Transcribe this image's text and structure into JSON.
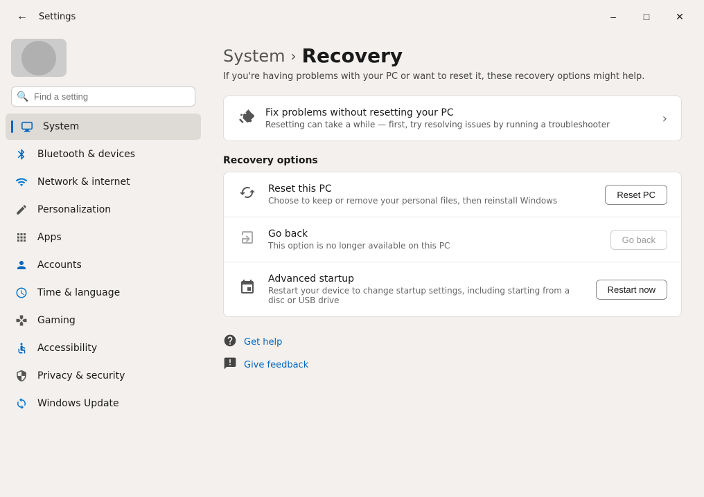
{
  "window": {
    "title": "Settings",
    "minimize": "–",
    "maximize": "□",
    "close": "✕"
  },
  "search": {
    "placeholder": "Find a setting"
  },
  "nav": {
    "items": [
      {
        "id": "system",
        "label": "System",
        "icon": "🖥",
        "active": true
      },
      {
        "id": "bluetooth",
        "label": "Bluetooth & devices",
        "icon": "🔵",
        "active": false
      },
      {
        "id": "network",
        "label": "Network & internet",
        "icon": "📶",
        "active": false
      },
      {
        "id": "personalization",
        "label": "Personalization",
        "icon": "✏️",
        "active": false
      },
      {
        "id": "apps",
        "label": "Apps",
        "icon": "📦",
        "active": false
      },
      {
        "id": "accounts",
        "label": "Accounts",
        "icon": "👤",
        "active": false
      },
      {
        "id": "time",
        "label": "Time & language",
        "icon": "🌐",
        "active": false
      },
      {
        "id": "gaming",
        "label": "Gaming",
        "icon": "🎮",
        "active": false
      },
      {
        "id": "accessibility",
        "label": "Accessibility",
        "icon": "♿",
        "active": false
      },
      {
        "id": "privacy",
        "label": "Privacy & security",
        "icon": "🛡",
        "active": false
      },
      {
        "id": "update",
        "label": "Windows Update",
        "icon": "🔄",
        "active": false
      }
    ]
  },
  "breadcrumb": {
    "parent": "System",
    "separator": "›",
    "current": "Recovery"
  },
  "subtitle": "If you're having problems with your PC or want to reset it, these recovery options might help.",
  "fix_card": {
    "title": "Fix problems without resetting your PC",
    "desc": "Resetting can take a while — first, try resolving issues by running a troubleshooter"
  },
  "recovery_options": {
    "section_title": "Recovery options",
    "items": [
      {
        "id": "reset-pc",
        "title": "Reset this PC",
        "desc": "Choose to keep or remove your personal files, then reinstall Windows",
        "btn_label": "Reset PC",
        "btn_disabled": false
      },
      {
        "id": "go-back",
        "title": "Go back",
        "desc": "This option is no longer available on this PC",
        "btn_label": "Go back",
        "btn_disabled": true
      },
      {
        "id": "advanced-startup",
        "title": "Advanced startup",
        "desc": "Restart your device to change startup settings, including starting from a disc or USB drive",
        "btn_label": "Restart now",
        "btn_disabled": false
      }
    ]
  },
  "footer_links": [
    {
      "id": "get-help",
      "label": "Get help"
    },
    {
      "id": "give-feedback",
      "label": "Give feedback"
    }
  ]
}
